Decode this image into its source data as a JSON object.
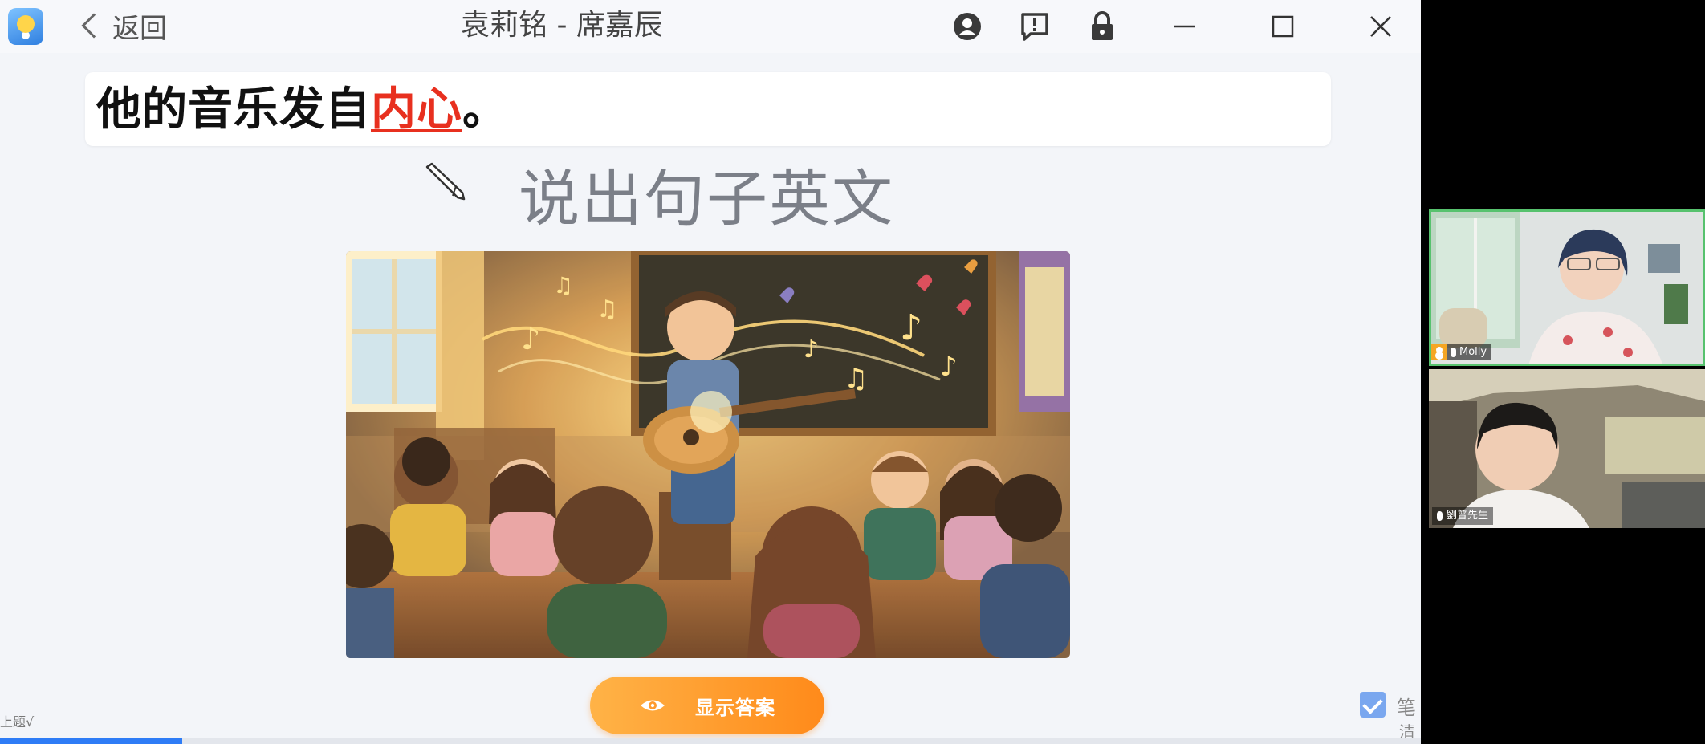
{
  "window": {
    "back_label": "返回",
    "title": "袁莉铭 - 席嘉辰"
  },
  "lesson": {
    "sentence_prefix": "他的音乐发自",
    "sentence_highlight": "内心",
    "sentence_suffix": "。",
    "prompt": "说出句子英文",
    "answer_button_label": "显示答案",
    "prev_label": "上题√",
    "progress": 0.128
  },
  "side_tools": {
    "pen_label": "笔",
    "clear_label": "清"
  },
  "participants": [
    {
      "name": "Molly",
      "role": "host",
      "active_speaker": true
    },
    {
      "name": "劉普先生",
      "role": "student",
      "active_speaker": false
    }
  ],
  "colors": {
    "highlight": "#e8301f",
    "answer_button": "#ff8a1a",
    "progress": "#2e7cf6",
    "active_speaker_border": "#57c26e"
  },
  "icons": [
    "app-logo",
    "chevron-left-icon",
    "user-circle-icon",
    "feedback-icon",
    "lock-icon",
    "minimize-icon",
    "maximize-icon",
    "close-icon",
    "pen-cursor-icon",
    "eye-icon",
    "checkbox-icon",
    "mic-icon"
  ]
}
